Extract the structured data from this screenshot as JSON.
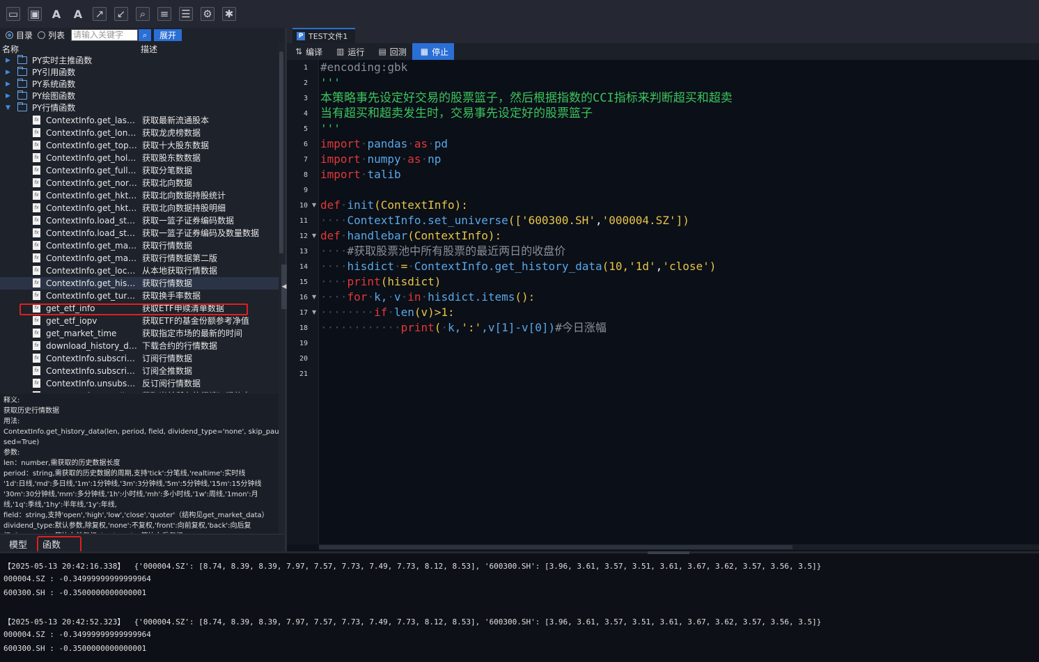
{
  "toolbar": {
    "icons": [
      "save-icon",
      "save-as-icon",
      "font-decrease-icon",
      "font-increase-icon",
      "export-icon",
      "import-icon",
      "search-icon",
      "document-icon",
      "list-document-icon",
      "settings-document-icon",
      "gear-document-icon"
    ],
    "font_decrease_label": "A",
    "font_increase_label": "A"
  },
  "left": {
    "radio_dir": "目录",
    "radio_list": "列表",
    "search_placeholder": "请输入关键字",
    "expand_label": "展开",
    "col_name": "名称",
    "col_desc": "描述",
    "folders": [
      {
        "label": "PY实时主推函数",
        "expanded": false
      },
      {
        "label": "PY引用函数",
        "expanded": false
      },
      {
        "label": "PY系统函数",
        "expanded": false
      },
      {
        "label": "PY绘图函数",
        "expanded": false
      },
      {
        "label": "PY行情函数",
        "expanded": true
      }
    ],
    "functions": [
      {
        "name": "ContextInfo.get_last_v...",
        "desc": "获取最新流通股本"
      },
      {
        "name": "ContextInfo.get_longh...",
        "desc": "获取龙虎榜数据"
      },
      {
        "name": "ContextInfo.get_top10...",
        "desc": "获取十大股东数据"
      },
      {
        "name": "ContextInfo.get_holder...",
        "desc": "获取股东数数据"
      },
      {
        "name": "ContextInfo.get_full_tick",
        "desc": "获取分笔数据"
      },
      {
        "name": "ContextInfo.get_north_...",
        "desc": "获取北向数据"
      },
      {
        "name": "ContextInfo.get_hkt_st...",
        "desc": "获取北向数据持股统计"
      },
      {
        "name": "ContextInfo.get_hkt_d...",
        "desc": "获取北向数据持股明细"
      },
      {
        "name": "ContextInfo.load_stk_list",
        "desc": "获取一篮子证券编码数据"
      },
      {
        "name": "ContextInfo.load_stk_v...",
        "desc": "获取一篮子证券编码及数量数据"
      },
      {
        "name": "ContextInfo.get_marke...",
        "desc": "获取行情数据"
      },
      {
        "name": "ContextInfo.get_marke...",
        "desc": "获取行情数据第二版"
      },
      {
        "name": "ContextInfo.get_local_...",
        "desc": "从本地获取行情数据"
      },
      {
        "name": "ContextInfo.get_histor...",
        "desc": "获取行情数据",
        "selected": true
      },
      {
        "name": "ContextInfo.get_turno...",
        "desc": "获取换手率数据"
      },
      {
        "name": "get_etf_info",
        "desc": "获取ETF申赎清单数据"
      },
      {
        "name": "get_etf_iopv",
        "desc": "获取ETF的基金份额参考净值"
      },
      {
        "name": "get_market_time",
        "desc": "获取指定市场的最新的时间"
      },
      {
        "name": "download_history_data",
        "desc": "下载合约的行情数据"
      },
      {
        "name": "ContextInfo.subscribe_...",
        "desc": "订阅行情数据"
      },
      {
        "name": "ContextInfo.subscribe_...",
        "desc": "订阅全推数据"
      },
      {
        "name": "ContextInfo.unsubscri...",
        "desc": "反订阅行情数据"
      },
      {
        "name": "ContextInfo.get_all_...",
        "desc": "获取当前所有的行情订阅信息"
      }
    ],
    "description": [
      "释义:",
      "获取历史行情数据",
      "用法:",
      "ContextInfo.get_history_data(len, period, field, dividend_type='none', skip_pau",
      "sed=True)",
      "参数:",
      "len：number,需获取的历史数据长度",
      "period：string,需获取的历史数据的周期,支持'tick':分笔线,'realtime':实时线",
      "'1d':日线,'md':多日线,'1m':1分钟线,'3m':3分钟线,'5m':5分钟线,'15m':15分钟线",
      "'30m':30分钟线,'mm':多分钟线,'1h':小时线,'mh':多小时线,'1w':周线,'1mon':月",
      "线,'1q':季线,'1hy':半年线,'1y':年线,",
      "field：string,支持'open','high','low','close','quoter'（结构见get_market_data）",
      "dividend_type:默认参数,除复权,'none':不复权,'front':向前复权,'back':向后复",
      "权,'front_ratio':等比向前复权,'back_ratio':等比向后复权"
    ],
    "tab_model": "模型",
    "tab_function": "函数"
  },
  "editor": {
    "tab_label": "TEST文件1",
    "tab_icon": "P",
    "run_buttons": [
      {
        "label": "编译",
        "icon": "compile-icon"
      },
      {
        "label": "运行",
        "icon": "run-icon"
      },
      {
        "label": "回测",
        "icon": "backtest-icon"
      },
      {
        "label": "停止",
        "icon": "stop-icon",
        "active": true
      }
    ],
    "line_numbers": [
      "1",
      "2",
      "3",
      "4",
      "5",
      "6",
      "7",
      "8",
      "9",
      "10",
      "11",
      "12",
      "13",
      "14",
      "15",
      "16",
      "17",
      "18",
      "19",
      "20",
      "21"
    ]
  },
  "code": {
    "l1": "#encoding:gbk",
    "l2": "'''",
    "l3": "本策略事先设定好交易的股票篮子，然后根据指数的CCI指标来判断超买和超卖",
    "l4": "当有超买和超卖发生时，交易事先设定好的股票篮子",
    "l5": "'''",
    "kw_import": "import",
    "kw_as": "as",
    "kw_def": "def",
    "kw_for": "for",
    "kw_in": "in",
    "kw_if": "if",
    "pandas": "pandas",
    "pd": "pd",
    "numpy": "numpy",
    "np": "np",
    "talib": "talib",
    "init_fn": "init",
    "init_args": "(ContextInfo):",
    "l11_a": "ContextInfo.set_universe",
    "l11_b": "([",
    "l11_c": "'600300.SH'",
    "l11_d": ",",
    "l11_e": "'000004.SZ'",
    "l11_f": "])",
    "handlebar_fn": "handlebar",
    "handlebar_args": "(ContextInfo):",
    "l13_comment": "#获取股票池中所有股票的最近两日的收盘价",
    "l14_a": "hisdict",
    "l14_b": "=",
    "l14_c": "ContextInfo.get_history_data",
    "l14_d": "(10,",
    "l14_e": "'1d'",
    "l14_f": ",",
    "l14_g": "'close'",
    "l14_h": ")",
    "print": "print",
    "l15_args": "(hisdict)",
    "l16_k": "k,",
    "l16_v": "v",
    "l16_iter": "hisdict.items",
    "l16_tail": "():",
    "l17_len": "len",
    "l17_tail": "(v)>1:",
    "l18_a": "(",
    "l18_b": "k,",
    "l18_c": "':'",
    "l18_d": ",v[1]-v[0])",
    "l18_comment": "#今日涨幅"
  },
  "output": {
    "lines": [
      "【2025-05-13 20:42:16.338】  {'000004.SZ': [8.74, 8.39, 8.39, 7.97, 7.57, 7.73, 7.49, 7.73, 8.12, 8.53], '600300.SH': [3.96, 3.61, 3.57, 3.51, 3.61, 3.67, 3.62, 3.57, 3.56, 3.5]}",
      "000004.SZ : -0.34999999999999964",
      "600300.SH : -0.3500000000000001",
      "",
      "【2025-05-13 20:42:52.323】  {'000004.SZ': [8.74, 8.39, 8.39, 7.97, 7.57, 7.73, 7.49, 7.73, 8.12, 8.53], '600300.SH': [3.96, 3.61, 3.57, 3.51, 3.61, 3.67, 3.62, 3.57, 3.56, 3.5]}",
      "000004.SZ : -0.34999999999999964",
      "600300.SH : -0.3500000000000001"
    ]
  }
}
